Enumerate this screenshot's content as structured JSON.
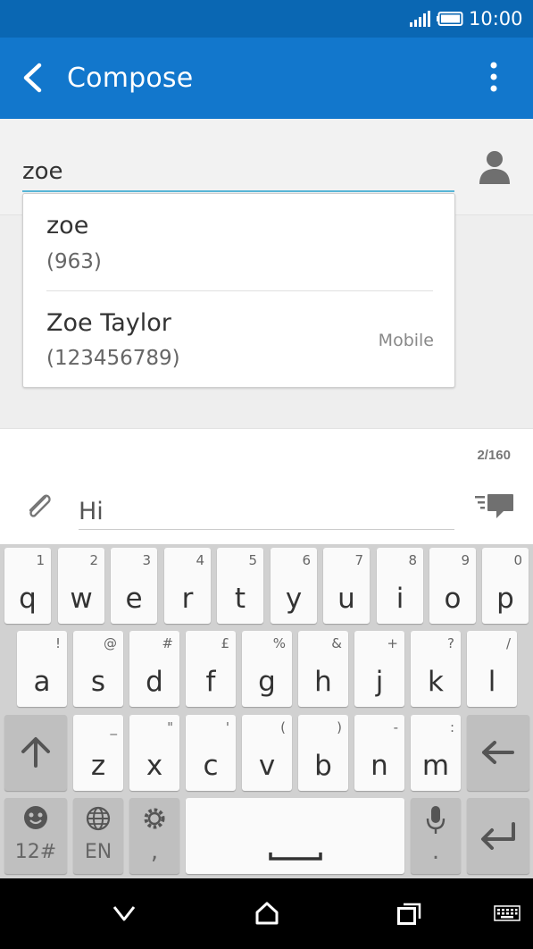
{
  "status_bar": {
    "time": "10:00"
  },
  "app_bar": {
    "title": "Compose"
  },
  "recipient": {
    "value": "zoe"
  },
  "suggestions": [
    {
      "name": "zoe",
      "number": "(963)",
      "type": ""
    },
    {
      "name": "Zoe Taylor",
      "number": "(123456789)",
      "type": "Mobile"
    }
  ],
  "message": {
    "char_count": "2/160",
    "value": "Hi"
  },
  "keyboard": {
    "row1": [
      {
        "key": "q",
        "sec": "1"
      },
      {
        "key": "w",
        "sec": "2"
      },
      {
        "key": "e",
        "sec": "3"
      },
      {
        "key": "r",
        "sec": "4"
      },
      {
        "key": "t",
        "sec": "5"
      },
      {
        "key": "y",
        "sec": "6"
      },
      {
        "key": "u",
        "sec": "7"
      },
      {
        "key": "i",
        "sec": "8"
      },
      {
        "key": "o",
        "sec": "9"
      },
      {
        "key": "p",
        "sec": "0"
      }
    ],
    "row2": [
      {
        "key": "a",
        "sec": "!"
      },
      {
        "key": "s",
        "sec": "@"
      },
      {
        "key": "d",
        "sec": "#"
      },
      {
        "key": "f",
        "sec": "£"
      },
      {
        "key": "g",
        "sec": "%"
      },
      {
        "key": "h",
        "sec": "&"
      },
      {
        "key": "j",
        "sec": "+"
      },
      {
        "key": "k",
        "sec": "?"
      },
      {
        "key": "l",
        "sec": "/"
      }
    ],
    "row3": [
      {
        "key": "z",
        "sec": "_"
      },
      {
        "key": "x",
        "sec": "\""
      },
      {
        "key": "c",
        "sec": "'"
      },
      {
        "key": "v",
        "sec": "("
      },
      {
        "key": "b",
        "sec": ")"
      },
      {
        "key": "n",
        "sec": "-"
      },
      {
        "key": "m",
        "sec": ":"
      }
    ],
    "symbols_label": "12#",
    "language_label": "EN",
    "comma_label": ",",
    "period_label": "."
  },
  "colors": {
    "status_bar": "#0a67b3",
    "app_bar": "#1277cc",
    "accent": "#56b5d6"
  }
}
